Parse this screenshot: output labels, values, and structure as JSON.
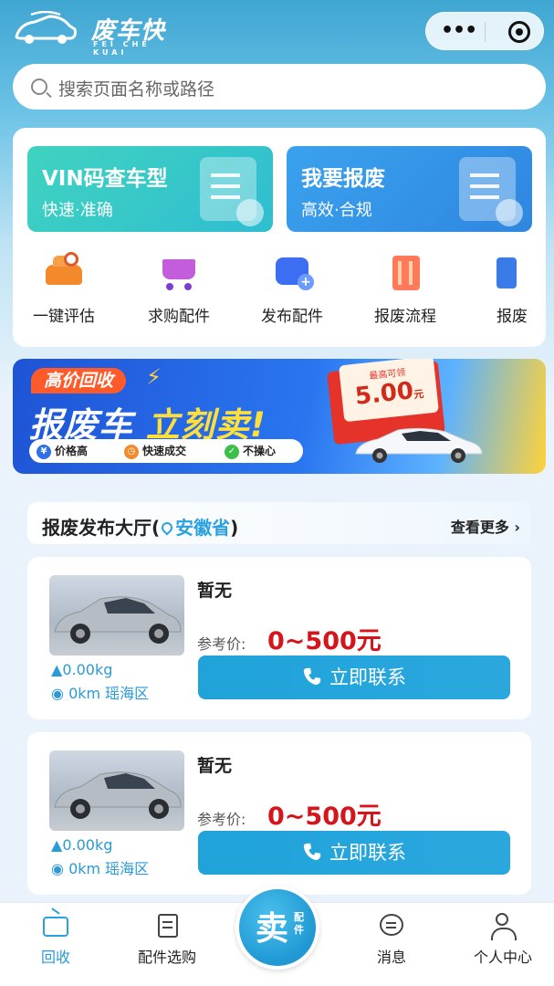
{
  "app": {
    "logo_title": "废车快",
    "logo_sub": "FEI CHE KUAI"
  },
  "search": {
    "placeholder": "搜索页面名称或路径"
  },
  "cards": [
    {
      "title": "VIN码查车型",
      "subtitle": "快速·准确"
    },
    {
      "title": "我要报废",
      "subtitle": "高效·合规"
    }
  ],
  "quick_actions": [
    {
      "label": "一键评估",
      "icon": "car-evaluate-icon"
    },
    {
      "label": "求购配件",
      "icon": "shopping-cart-icon"
    },
    {
      "label": "发布配件",
      "icon": "publish-bag-icon"
    },
    {
      "label": "报废流程",
      "icon": "process-icon"
    },
    {
      "label": "报废",
      "icon": "scrap-icon"
    }
  ],
  "banner": {
    "tag": "高价回收",
    "main_prefix": "报废车",
    "main_highlight": "立刻卖!",
    "features": [
      "价格高",
      "快速成交",
      "不操心"
    ],
    "voucher_caption": "最高可领",
    "voucher_amount": "5.00",
    "voucher_unit": "元"
  },
  "section": {
    "title_prefix": "报废发布大厅(",
    "location": "安徽省",
    "title_suffix": ")",
    "more": "查看更多"
  },
  "listings": [
    {
      "name": "暂无",
      "ref_label": "参考价:",
      "price": "0~500元",
      "weight": "0.00kg",
      "distance": "0km 瑶海区",
      "button": "立即联系"
    },
    {
      "name": "暂无",
      "ref_label": "参考价:",
      "price": "0~500元",
      "weight": "0.00kg",
      "distance": "0km 瑶海区",
      "button": "立即联系"
    }
  ],
  "tabbar": {
    "items": [
      {
        "label": "回收",
        "active": true
      },
      {
        "label": "配件选购"
      },
      {
        "label": "消息"
      },
      {
        "label": "个人中心"
      }
    ],
    "sell_big": "卖",
    "sell_small": "配件"
  },
  "colors": {
    "accent": "#2aa0e0",
    "price_red": "#d5151b",
    "vin_card": "#3fd3c0",
    "scrap_card": "#3aa2ee"
  }
}
